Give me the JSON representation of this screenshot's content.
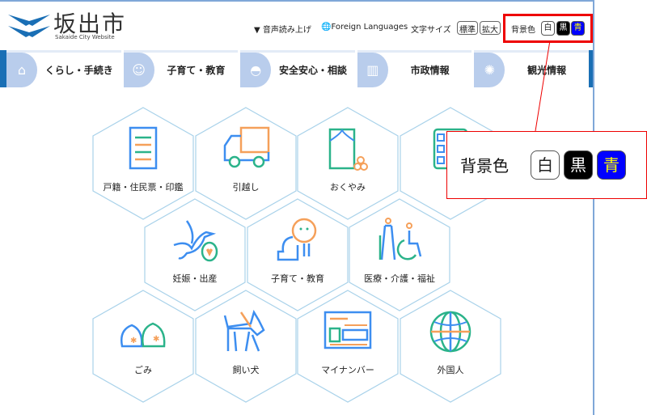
{
  "header": {
    "title": "坂出市",
    "subtitle": "Sakaide City Website"
  },
  "toolbar": {
    "read_aloud": "音声読み上げ",
    "foreign_languages": "Foreign Languages",
    "font_size_label": "文字サイズ",
    "font_standard": "標準",
    "font_large": "拡大",
    "bg_color_label": "背景色",
    "bg_white": "白",
    "bg_black": "黒",
    "bg_blue": "青"
  },
  "nav": [
    {
      "label": "くらし・手続き",
      "icon": "house-icon"
    },
    {
      "label": "子育て・教育",
      "icon": "baby-icon"
    },
    {
      "label": "安全安心・相談",
      "icon": "helmet-icon"
    },
    {
      "label": "市政情報",
      "icon": "building-icon"
    },
    {
      "label": "観光情報",
      "icon": "firework-icon"
    }
  ],
  "tiles": [
    {
      "label": "戸籍・住民票・印鑑",
      "icon": "document-icon"
    },
    {
      "label": "引越し",
      "icon": "truck-icon"
    },
    {
      "label": "おくやみ",
      "icon": "condolence-icon"
    },
    {
      "label": "",
      "icon": "calendar-icon"
    },
    {
      "label": "妊娠・出産",
      "icon": "stork-icon"
    },
    {
      "label": "子育て・教育",
      "icon": "child-icon"
    },
    {
      "label": "医療・介護・福祉",
      "icon": "wheelchair-icon"
    },
    {
      "label": "ごみ",
      "icon": "garbage-bag-icon"
    },
    {
      "label": "飼い犬",
      "icon": "dog-icon"
    },
    {
      "label": "マイナンバー",
      "icon": "id-card-icon"
    },
    {
      "label": "外国人",
      "icon": "globe-icon"
    }
  ],
  "popup": {
    "label": "背景色",
    "white": "白",
    "black": "黒",
    "blue": "青"
  },
  "colors": {
    "nav_accent": "#1a6fb5",
    "highlight": "#ee0000",
    "blue_bg": "#0000ff",
    "icon_blue": "#3d8ef0",
    "icon_orange": "#f5a05a",
    "icon_green": "#2bb38a"
  }
}
